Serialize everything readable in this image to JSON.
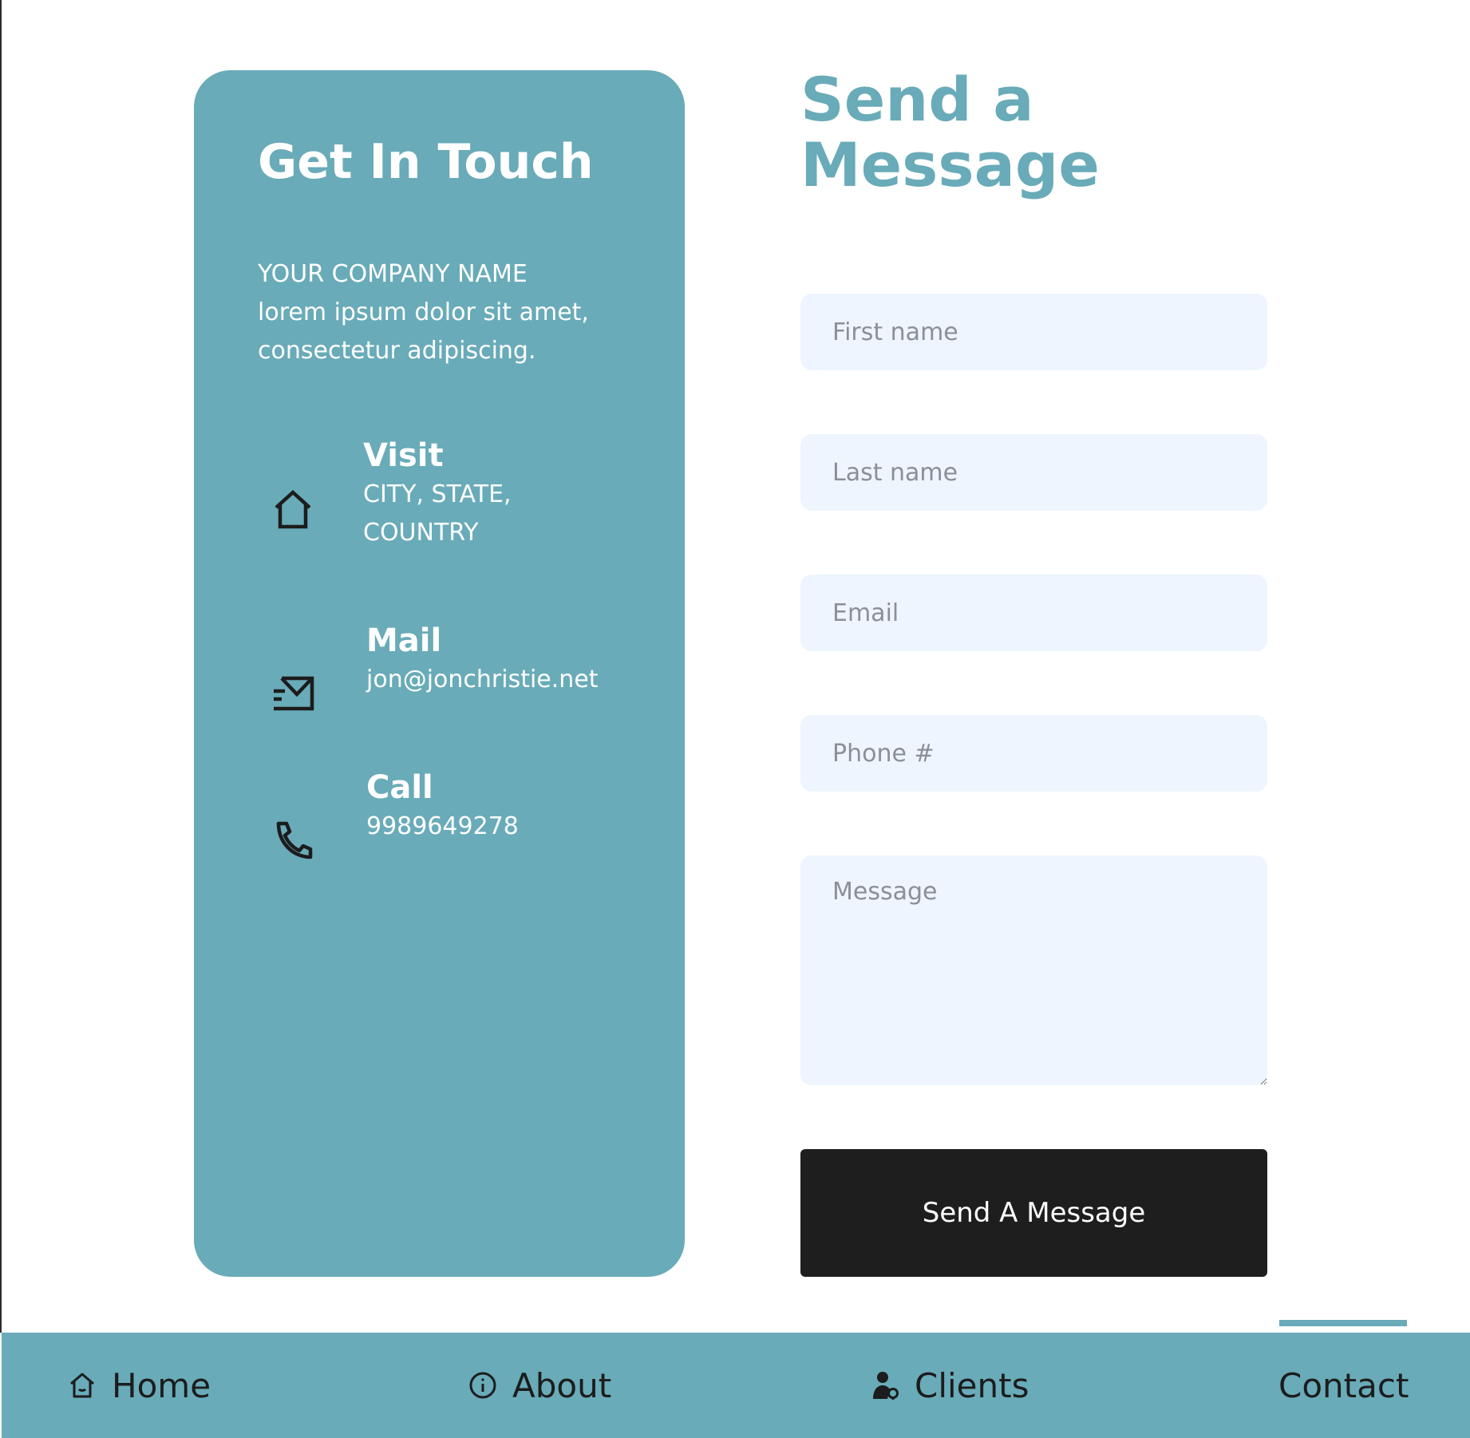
{
  "card": {
    "title": "Get In Touch",
    "description_lines": [
      "YOUR COMPANY NAME",
      "lorem ipsum dolor sit amet,",
      "consectetur adipiscing."
    ],
    "visit": {
      "heading": "Visit",
      "lines": [
        "CITY, STATE,",
        "COUNTRY"
      ],
      "icon": "house-icon"
    },
    "mail": {
      "heading": "Mail",
      "value": "jon@jonchristie.net",
      "icon": "envelope-icon"
    },
    "call": {
      "heading": "Call",
      "value": "9989649278",
      "icon": "phone-icon"
    }
  },
  "form": {
    "title_lines": [
      "Send a",
      "Message"
    ],
    "first_name_placeholder": "First name",
    "last_name_placeholder": "Last name",
    "email_placeholder": "Email",
    "phone_placeholder": "Phone #",
    "message_placeholder": "Message",
    "submit_label": "Send A Message"
  },
  "nav": {
    "items": [
      {
        "label": "Home",
        "icon": "house-icon"
      },
      {
        "label": "About",
        "icon": "info-icon"
      },
      {
        "label": "Clients",
        "icon": "user-icon"
      },
      {
        "label": "Contact",
        "icon": ""
      }
    ],
    "active": "Contact"
  },
  "colors": {
    "accent": "#69abb8",
    "input_bg": "#eef5fe",
    "button_bg": "#1e1e1e"
  }
}
